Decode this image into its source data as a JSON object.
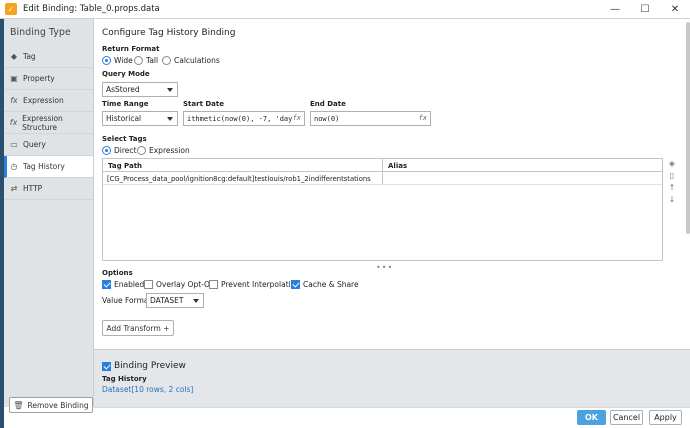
{
  "window": {
    "title": "Edit Binding: Table_0.props.data",
    "app_icon": "ignition-icon",
    "minimize": "—",
    "maximize": "☐",
    "close": "✕"
  },
  "sidebar": {
    "header": "Binding Type",
    "items": [
      {
        "label": "Tag",
        "icon": "tag-icon",
        "glyph": "◆"
      },
      {
        "label": "Property",
        "icon": "property-icon",
        "glyph": "▣"
      },
      {
        "label": "Expression",
        "icon": "fx-icon",
        "glyph": "fx"
      },
      {
        "label": "Expression Structure",
        "icon": "fx-icon",
        "glyph": "fx"
      },
      {
        "label": "Query",
        "icon": "query-icon",
        "glyph": "▭"
      },
      {
        "label": "Tag History",
        "icon": "clock-icon",
        "glyph": "◷"
      },
      {
        "label": "HTTP",
        "icon": "http-icon",
        "glyph": "⇄"
      }
    ],
    "active_index": 5,
    "remove_button": "Remove Binding"
  },
  "main": {
    "heading": "Configure Tag History Binding",
    "return_format": {
      "label": "Return Format",
      "options": [
        "Wide",
        "Tall",
        "Calculations"
      ],
      "selected": "Wide"
    },
    "query_mode": {
      "label": "Query Mode",
      "value": "AsStored"
    },
    "time_range": {
      "label": "Time Range",
      "value": "Historical"
    },
    "start_date": {
      "label": "Start Date",
      "value": "ithmetic(now(0), -7, 'day')",
      "fx": "fx"
    },
    "end_date": {
      "label": "End Date",
      "value": "now(0)",
      "fx": "fx"
    },
    "select_tags": {
      "label": "Select Tags",
      "options": [
        "Direct",
        "Expression"
      ],
      "selected": "Direct"
    },
    "table": {
      "columns": [
        "Tag Path",
        "Alias"
      ],
      "rows": [
        [
          "[CG_Process_data_pool/ignition8cg:default]testlouis/rob1_2indifferentstations",
          ""
        ]
      ]
    },
    "side_icons": [
      "tag-add-icon",
      "trash-icon",
      "arrow-up-icon",
      "arrow-down-icon"
    ],
    "options": {
      "label": "Options",
      "checks": [
        {
          "label": "Enabled",
          "checked": true
        },
        {
          "label": "Overlay Opt-Out",
          "checked": false
        },
        {
          "label": "Prevent Interpolation",
          "checked": false
        },
        {
          "label": "Cache & Share",
          "checked": true
        }
      ],
      "value_format_label": "Value Format",
      "value_format": "DATASET"
    },
    "add_transform": "Add Transform +"
  },
  "preview": {
    "title": "Binding Preview",
    "checked": true,
    "label": "Tag History",
    "value": "Dataset[10 rows, 2 cols]"
  },
  "footer": {
    "ok": "OK",
    "cancel": "Cancel",
    "apply": "Apply"
  },
  "colors": {
    "accent": "#2a7de1",
    "ok_button": "#4aa3df",
    "sidebar_bg": "#dfe3e6",
    "preview_bg": "#e4e7ea",
    "app_icon": "#f7a21b"
  }
}
